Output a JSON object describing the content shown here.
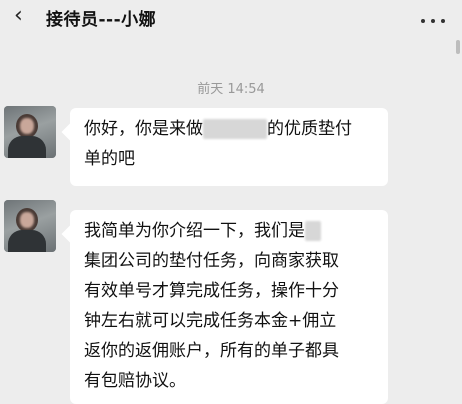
{
  "header": {
    "back_icon": "chevron-left-icon",
    "title": "接待员---小娜",
    "more_icon": "more-dots-icon"
  },
  "timestamp": "前天 14:54",
  "messages": [
    {
      "lines": [
        "你好，你是来做",
        "的优质垫付",
        "单的吧"
      ]
    },
    {
      "lines": [
        "我简单为你介绍一下，我们是",
        "集团公司的垫付任务，向商家获取",
        "有效单号才算完成任务，操作十分",
        "钟左右就可以完成任务本金+佣立",
        "返你的返佣账户，所有的单子都具",
        "有包赔协议。"
      ]
    }
  ]
}
